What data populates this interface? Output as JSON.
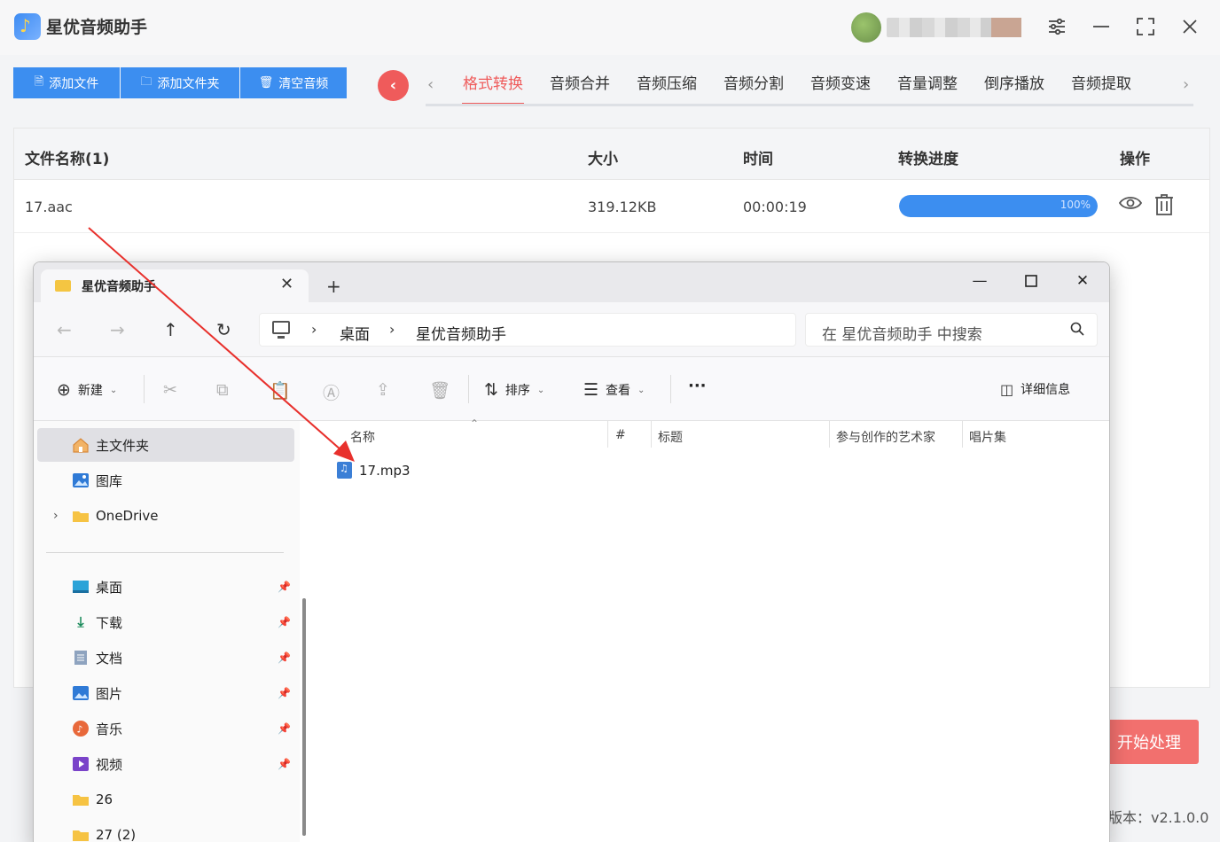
{
  "app": {
    "title": "星优音频助手",
    "version": "版本：v2.1.0.0"
  },
  "toolbar": {
    "add_file": "添加文件",
    "add_folder": "添加文件夹",
    "clear": "清空音频"
  },
  "tabs": [
    "格式转换",
    "音频合并",
    "音频压缩",
    "音频分割",
    "音频变速",
    "音量调整",
    "倒序播放",
    "音频提取"
  ],
  "active_tab": "格式转换",
  "table": {
    "headers": {
      "name": "文件名称(1)",
      "size": "大小",
      "time": "时间",
      "progress": "转换进度",
      "action": "操作"
    },
    "rows": [
      {
        "name": "17.aac",
        "size": "319.12KB",
        "time": "00:00:19",
        "progress": 1.0,
        "progress_label": "100%"
      }
    ]
  },
  "start_button": "开始处理",
  "explorer": {
    "tab_title": "星优音频助手",
    "breadcrumb": [
      "桌面",
      "星优音频助手"
    ],
    "search_placeholder": "在 星优音频助手 中搜索",
    "toolbar": {
      "new": "新建",
      "sort": "排序",
      "view": "查看",
      "more": "···",
      "details": "详细信息"
    },
    "sidebar_top": [
      {
        "label": "主文件夹",
        "icon": "home-icon",
        "selected": true
      },
      {
        "label": "图库",
        "icon": "gallery-icon",
        "selected": false
      },
      {
        "label": "OneDrive",
        "icon": "folder-icon",
        "selected": false
      }
    ],
    "sidebar_quick": [
      {
        "label": "桌面",
        "icon": "desktop-icon"
      },
      {
        "label": "下载",
        "icon": "download-icon"
      },
      {
        "label": "文档",
        "icon": "document-icon"
      },
      {
        "label": "图片",
        "icon": "pictures-icon"
      },
      {
        "label": "音乐",
        "icon": "music-icon"
      },
      {
        "label": "视频",
        "icon": "video-icon"
      },
      {
        "label": "26",
        "icon": "folder-icon"
      },
      {
        "label": "27 (2)",
        "icon": "folder-icon"
      }
    ],
    "columns": [
      "名称",
      "#",
      "标题",
      "参与创作的艺术家",
      "唱片集"
    ],
    "files": [
      {
        "name": "17.mp3",
        "icon": "audio-file-icon"
      }
    ]
  },
  "colors": {
    "accent_blue": "#3c8ef0",
    "accent_red": "#ef5b5b",
    "arrow_red": "#e8302c"
  }
}
